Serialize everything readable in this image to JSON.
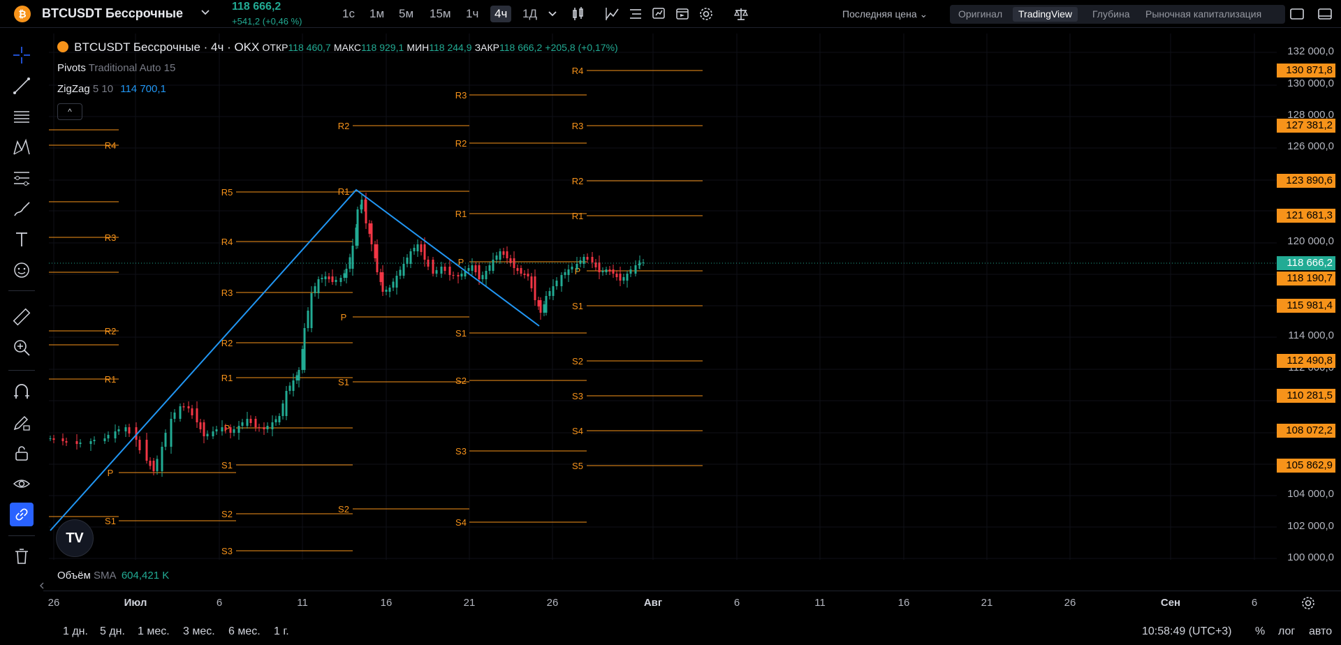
{
  "topbar": {
    "coin_symbol": "₿",
    "symbol": "BTCUSDT Бессрочные",
    "last_price": "118 666,2",
    "change": "+541,2 (+0,46 %)",
    "timeframes": [
      "1с",
      "1м",
      "5м",
      "15м",
      "1ч",
      "4ч",
      "1Д"
    ],
    "active_timeframe": "4ч",
    "price_type": "Последняя цена",
    "views": [
      "Оригинал",
      "TradingView",
      "Глубина",
      "Рыночная капитализация"
    ],
    "active_view": "TradingView"
  },
  "left_toolbar": {
    "tools": [
      "crosshair-icon",
      "trend-line-icon",
      "horizontal-lines-icon",
      "pattern-icon",
      "fib-icon",
      "brush-icon",
      "text-icon",
      "emoji-icon",
      "ruler-icon",
      "zoom-icon",
      "magnet-icon",
      "pencil-lock-icon",
      "lock-icon",
      "eye-icon",
      "link-icon",
      "trash-icon"
    ],
    "active_tool": "link-icon"
  },
  "chart_legend": {
    "title": "BTCUSDT Бессрочные · 4ч · OKX",
    "open_label": "ОТКР",
    "open": "118 460,7",
    "high_label": "МАКС",
    "high": "118 929,1",
    "low_label": "МИН",
    "low": "118 244,9",
    "close_label": "ЗАКР",
    "close": "118 666,2",
    "change": "+205,8 (+0,17%)",
    "pivots_label": "Pivots",
    "pivots_params": "Traditional Auto 15",
    "zigzag_label": "ZigZag",
    "zigzag_params": "5 10",
    "zigzag_value": "114 700,1",
    "collapse_symbol": "^",
    "volume_label": "Объём",
    "volume_sma": "SMA",
    "volume_value": "604,421 K",
    "tv_logo": "TV"
  },
  "price_axis": {
    "labels": [
      "132 000,0",
      "130 000,0",
      "128 000,0",
      "126 000,0",
      "120 000,0",
      "114 000,0",
      "112 000,0",
      "104 000,0",
      "102 000,0",
      "100 000,0"
    ],
    "tags": [
      {
        "value": "130 871,8",
        "color": "#f7931a"
      },
      {
        "value": "127 381,2",
        "color": "#f7931a"
      },
      {
        "value": "123 890,6",
        "color": "#f7931a"
      },
      {
        "value": "121 681,3",
        "color": "#f7931a"
      },
      {
        "value": "118 666,2",
        "color": "#22ab94"
      },
      {
        "value": "118 190,7",
        "color": "#f7931a"
      },
      {
        "value": "115 981,4",
        "color": "#f7931a"
      },
      {
        "value": "112 490,8",
        "color": "#f7931a"
      },
      {
        "value": "110 281,5",
        "color": "#f7931a"
      },
      {
        "value": "108 072,2",
        "color": "#f7931a"
      },
      {
        "value": "105 862,9",
        "color": "#f7931a"
      }
    ]
  },
  "pivot_levels": {
    "block1": [
      "R4",
      "R3",
      "R2",
      "R1",
      "P",
      "S1"
    ],
    "block2": [
      "R5",
      "R4",
      "R3",
      "R2",
      "R1",
      "P",
      "S1",
      "S2",
      "S3"
    ],
    "block3": [
      "R2",
      "R1",
      "P",
      "S1",
      "S2"
    ],
    "block4": [
      "R3",
      "R2",
      "R1",
      "P",
      "S1",
      "S2",
      "S3",
      "S4"
    ],
    "block5": [
      "R4",
      "R3",
      "R2",
      "R1",
      "P",
      "S1",
      "S2",
      "S3",
      "S4",
      "S5"
    ]
  },
  "time_axis": {
    "labels": [
      "26",
      "Июл",
      "6",
      "11",
      "16",
      "21",
      "26",
      "Авг",
      "6",
      "11",
      "16",
      "21",
      "26",
      "Сен",
      "6"
    ]
  },
  "bottom_bar": {
    "ranges": [
      "1 дн.",
      "5 дн.",
      "1 мес.",
      "3 мес.",
      "6 мес.",
      "1 г."
    ],
    "clock": "10:58:49 (UTC+3)",
    "percent": "%",
    "log": "лог",
    "auto": "авто"
  },
  "colors": {
    "up": "#22ab94",
    "down": "#f23645",
    "pivot": "#f7931a",
    "zigzag": "#2196f3",
    "accent": "#2962ff"
  }
}
